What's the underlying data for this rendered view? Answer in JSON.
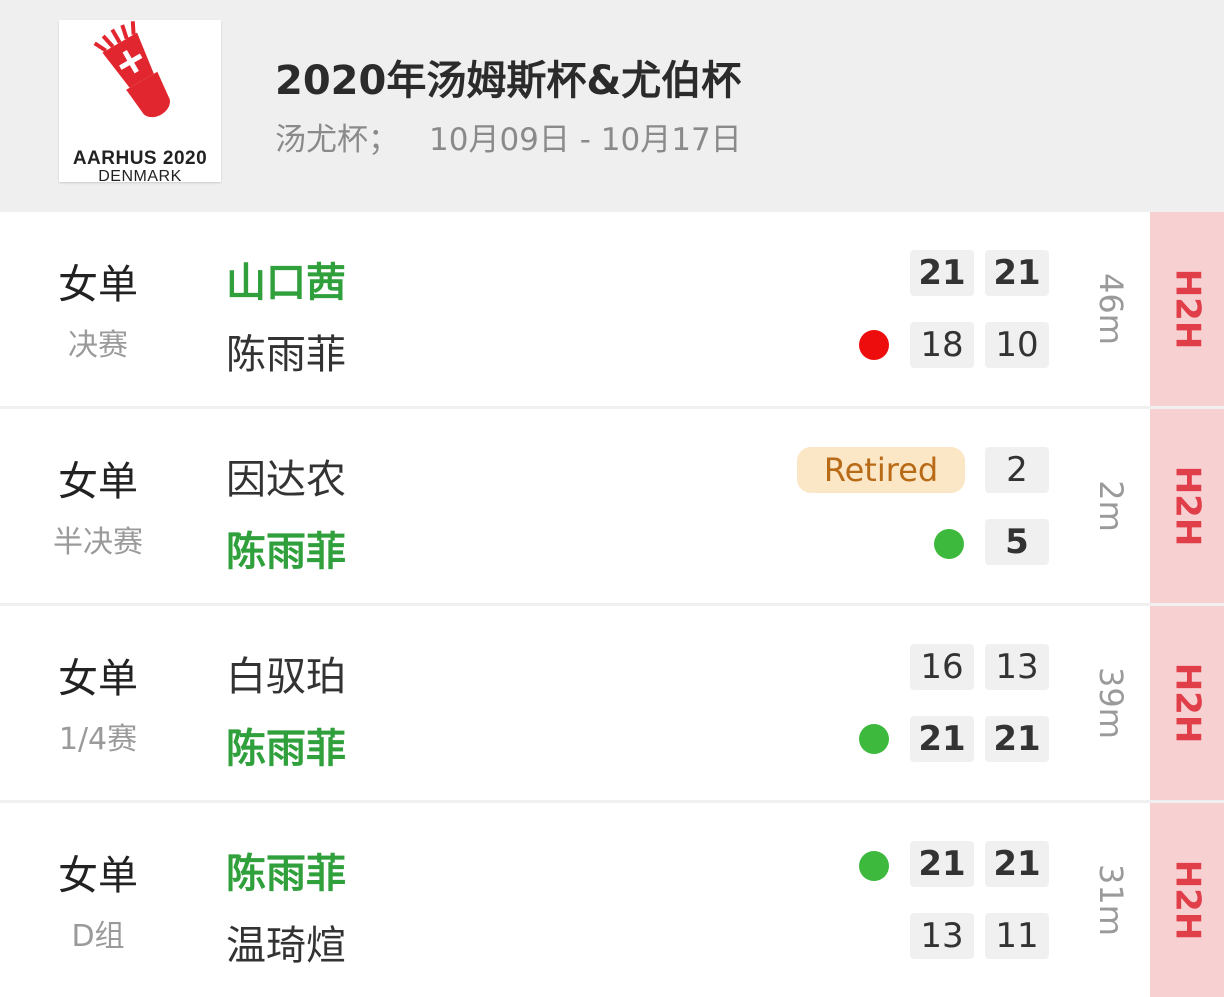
{
  "header": {
    "logo_line1": "AARHUS 2020",
    "logo_line2": "DENMARK",
    "title": "2020年汤姆斯杯&尤伯杯",
    "category": "汤尤杯；",
    "dates": "10月09日 - 10月17日"
  },
  "colors": {
    "winner_green": "#2fa03b",
    "h2h_bg": "#f7d0d2",
    "h2h_text": "#e03f4a",
    "retired_bg": "#fbe6c6",
    "retired_text": "#b86a16",
    "serve_dot_red": "#ee0d0d",
    "serve_dot_green": "#3dba3d"
  },
  "matches": [
    {
      "event": "女单",
      "round": "决赛",
      "player1": "山口茜",
      "player2": "陈雨菲",
      "p1_scores": [
        "21",
        "21"
      ],
      "p2_scores": [
        "18",
        "10"
      ],
      "duration": "46m",
      "h2h": "H2H"
    },
    {
      "event": "女单",
      "round": "半决赛",
      "player1": "因达农",
      "player2": "陈雨菲",
      "status": "Retired",
      "p1_scores": [
        "2"
      ],
      "p2_scores": [
        "5"
      ],
      "duration": "2m",
      "h2h": "H2H"
    },
    {
      "event": "女单",
      "round": "1/4赛",
      "player1": "白驭珀",
      "player2": "陈雨菲",
      "p1_scores": [
        "16",
        "13"
      ],
      "p2_scores": [
        "21",
        "21"
      ],
      "duration": "39m",
      "h2h": "H2H"
    },
    {
      "event": "女单",
      "round": "D组",
      "player1": "陈雨菲",
      "player2": "温琦煊",
      "p1_scores": [
        "21",
        "21"
      ],
      "p2_scores": [
        "13",
        "11"
      ],
      "duration": "31m",
      "h2h": "H2H"
    }
  ]
}
